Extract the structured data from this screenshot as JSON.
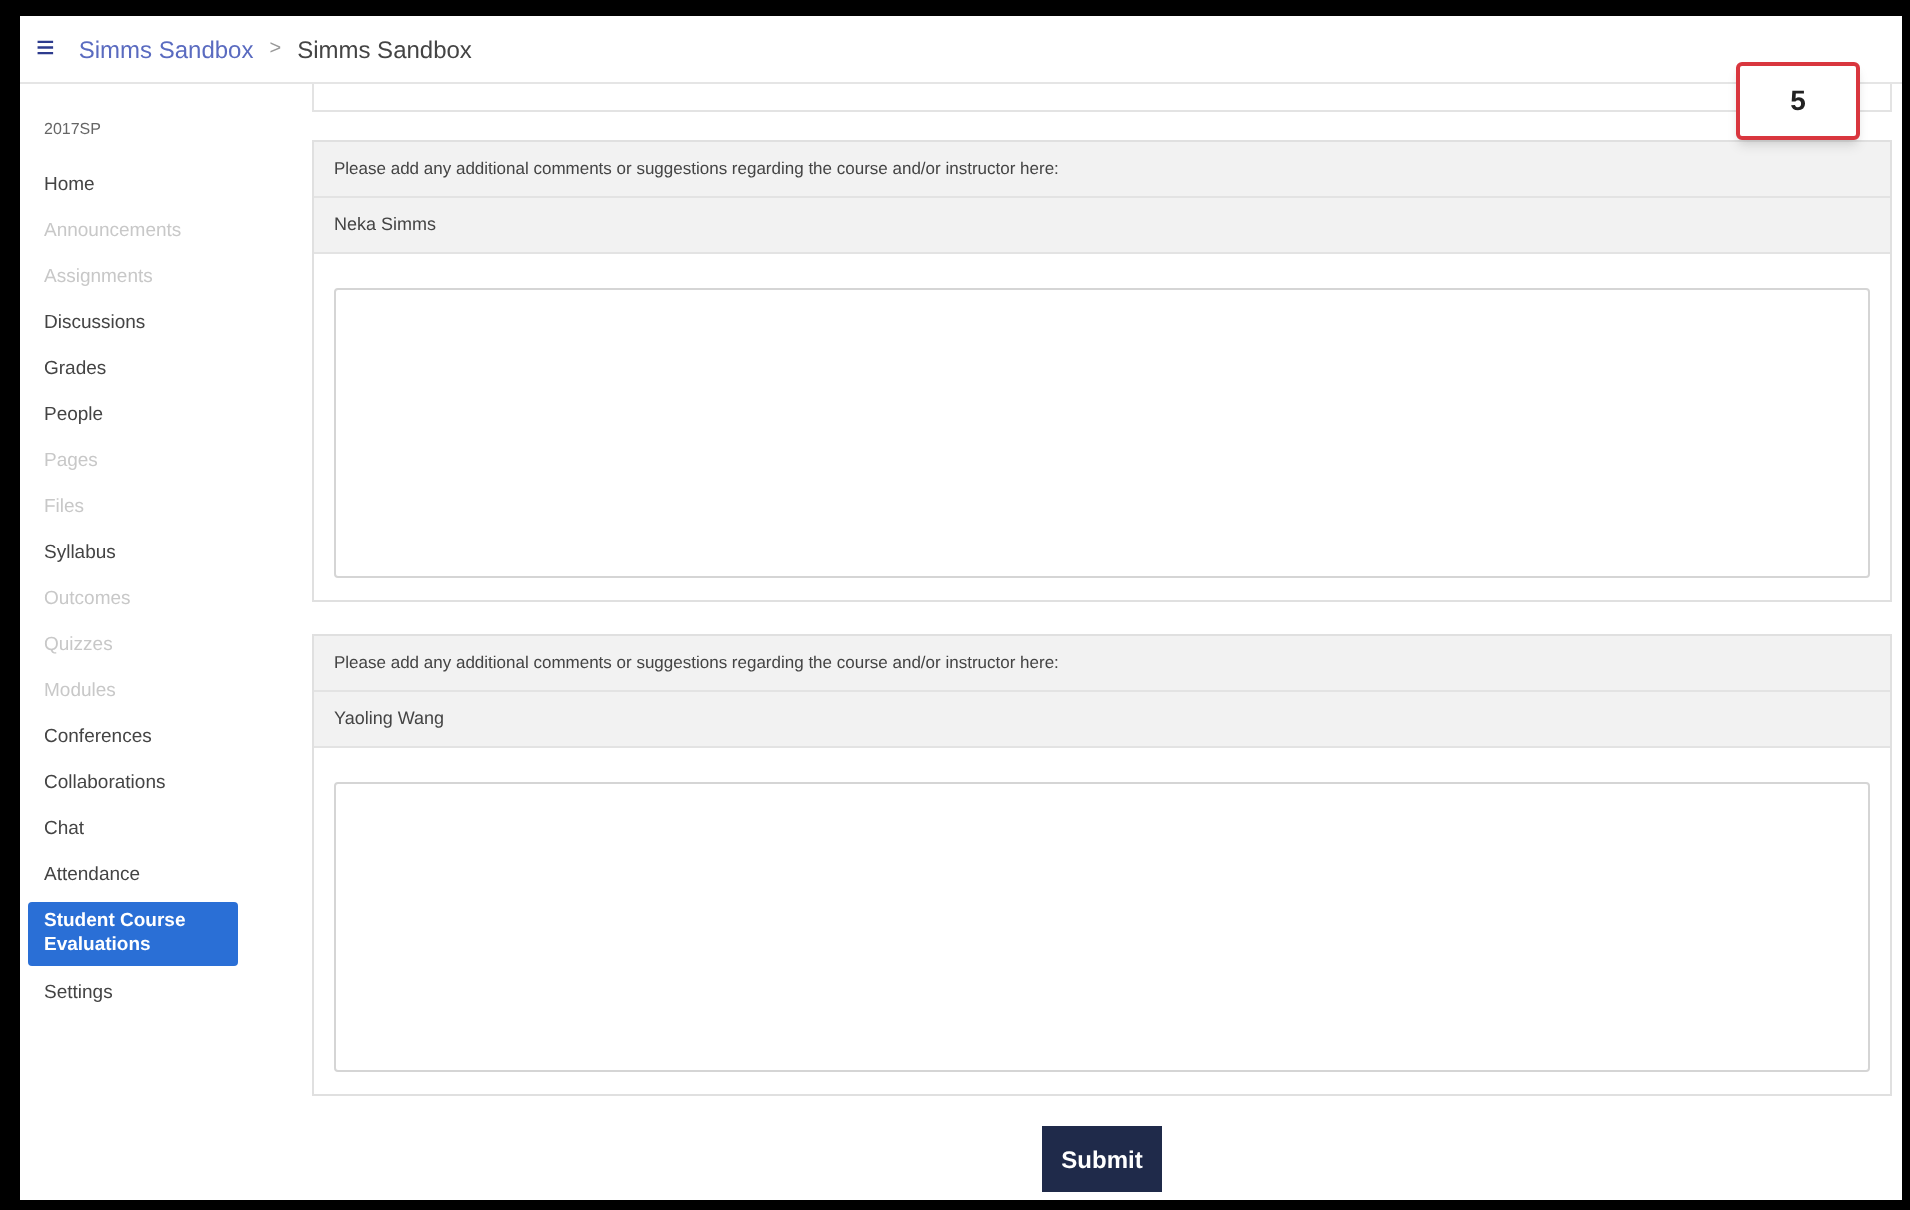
{
  "breadcrumb": {
    "menu_icon": "≡",
    "course": "Simms Sandbox",
    "separator": ">",
    "current": "Simms Sandbox"
  },
  "sidebar": {
    "term": "2017SP",
    "items": [
      {
        "label": "Home",
        "disabled": false,
        "selected": false
      },
      {
        "label": "Announcements",
        "disabled": true,
        "selected": false
      },
      {
        "label": "Assignments",
        "disabled": true,
        "selected": false
      },
      {
        "label": "Discussions",
        "disabled": false,
        "selected": false
      },
      {
        "label": "Grades",
        "disabled": false,
        "selected": false
      },
      {
        "label": "People",
        "disabled": false,
        "selected": false
      },
      {
        "label": "Pages",
        "disabled": true,
        "selected": false
      },
      {
        "label": "Files",
        "disabled": true,
        "selected": false
      },
      {
        "label": "Syllabus",
        "disabled": false,
        "selected": false
      },
      {
        "label": "Outcomes",
        "disabled": true,
        "selected": false
      },
      {
        "label": "Quizzes",
        "disabled": true,
        "selected": false
      },
      {
        "label": "Modules",
        "disabled": true,
        "selected": false
      },
      {
        "label": "Conferences",
        "disabled": false,
        "selected": false
      },
      {
        "label": "Collaborations",
        "disabled": false,
        "selected": false
      },
      {
        "label": "Chat",
        "disabled": false,
        "selected": false
      },
      {
        "label": "Attendance",
        "disabled": false,
        "selected": false
      },
      {
        "label": "Student Course Evaluations",
        "disabled": false,
        "selected": true
      },
      {
        "label": "Settings",
        "disabled": false,
        "selected": false
      }
    ]
  },
  "questions": [
    {
      "prompt": "Please add any additional comments or suggestions regarding the course and/or instructor here:",
      "instructor": "Neka Simms"
    },
    {
      "prompt": "Please add any additional comments or suggestions regarding the course and/or instructor here:",
      "instructor": "Yaoling Wang"
    }
  ],
  "submit_button": "Submit",
  "callout": "5"
}
